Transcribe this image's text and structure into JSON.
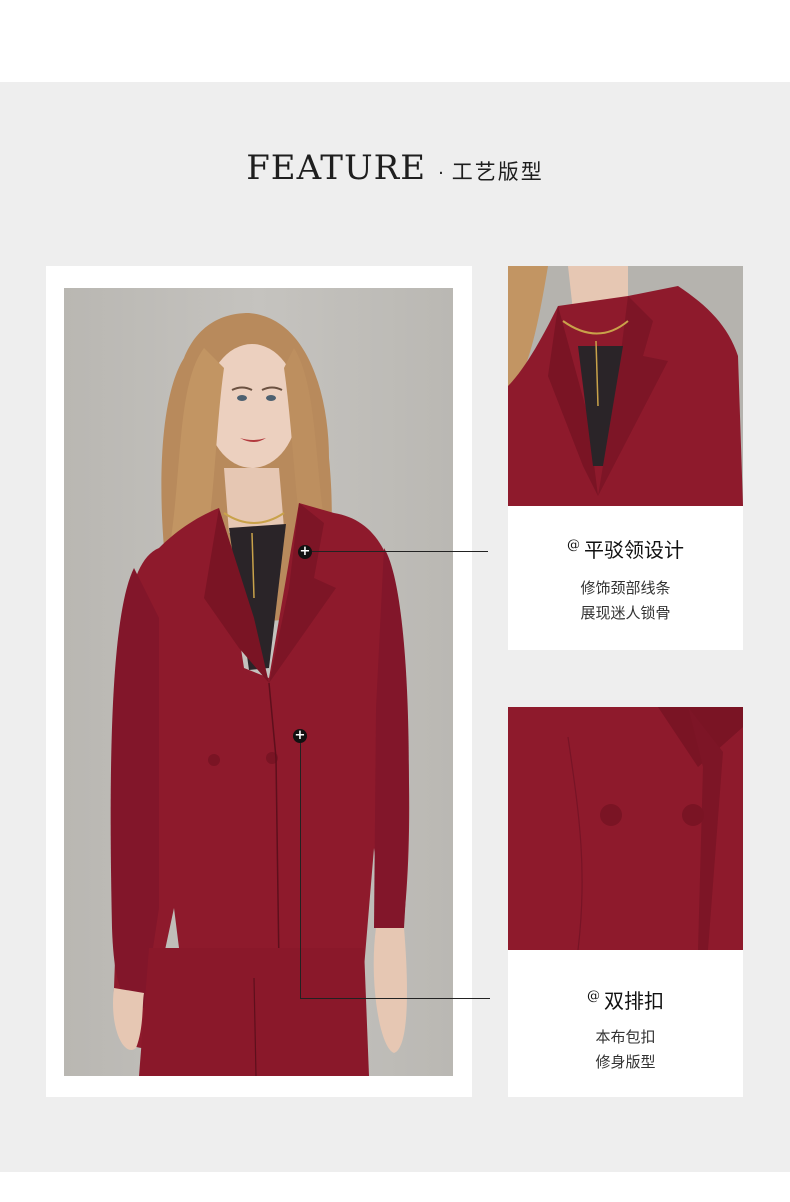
{
  "header": {
    "title_en": "FEATURE",
    "separator": "·",
    "title_cn": "工艺版型"
  },
  "features": [
    {
      "marker": "@",
      "title": "平驳领设计",
      "desc_line1": "修饰颈部线条",
      "desc_line2": "展现迷人锁骨"
    },
    {
      "marker": "@",
      "title": "双排扣",
      "desc_line1": "本布包扣",
      "desc_line2": "修身版型"
    }
  ],
  "hotspot_symbol": "+",
  "colors": {
    "suit": "#8e1a2c",
    "background": "#eeeeee",
    "card": "#ffffff",
    "text": "#1e1e1e"
  }
}
